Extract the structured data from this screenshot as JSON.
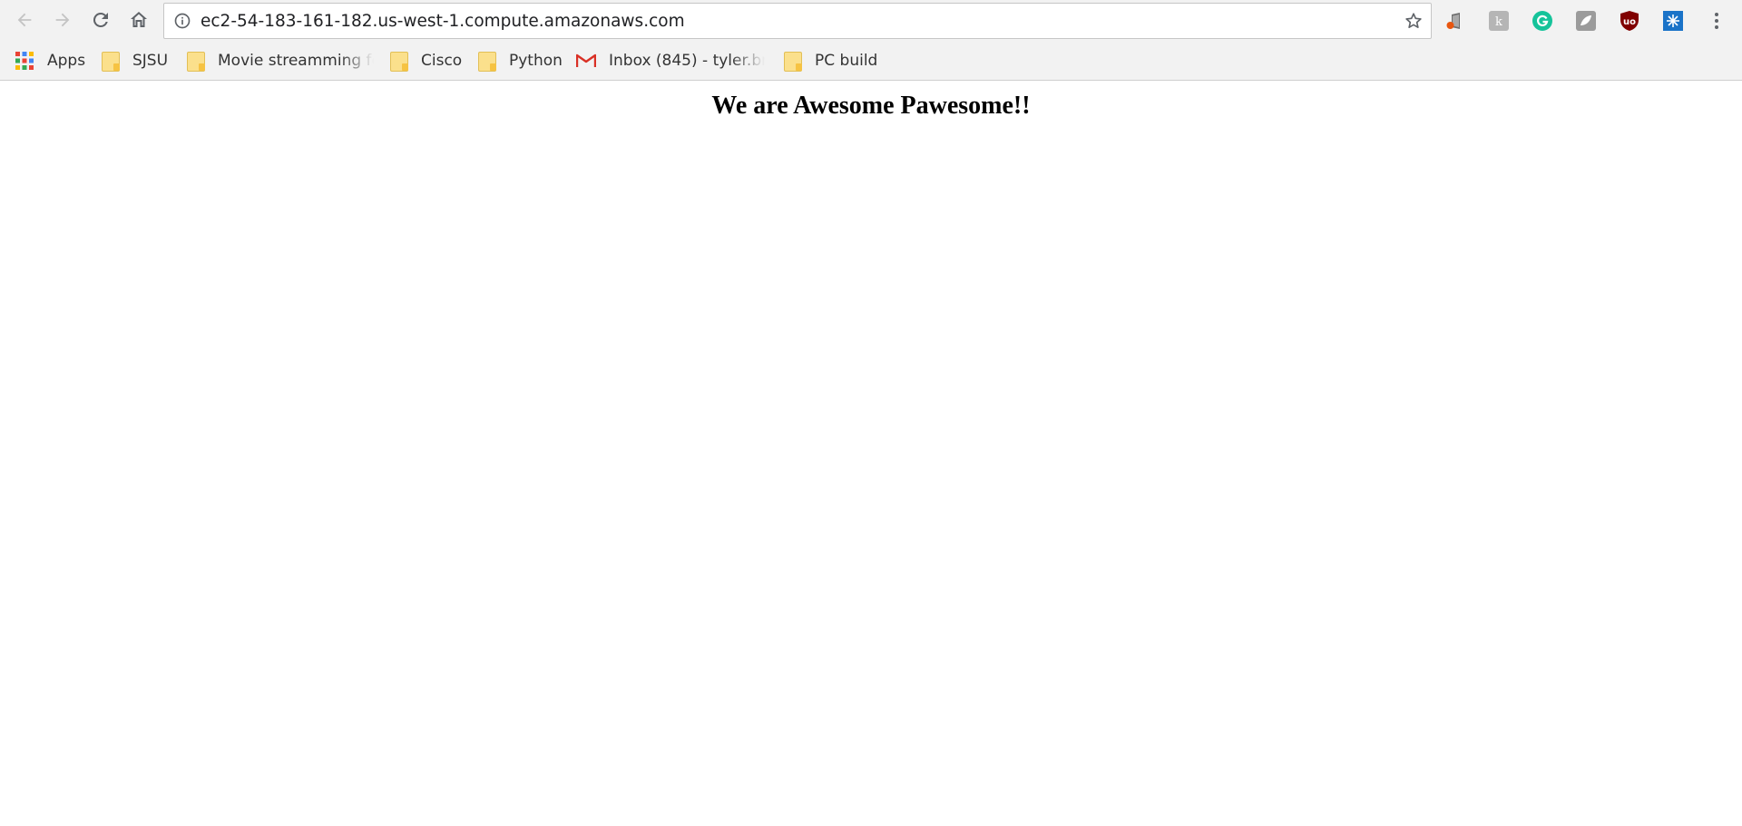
{
  "toolbar": {
    "back_icon": "arrow-left-icon",
    "forward_icon": "arrow-right-icon",
    "reload_icon": "reload-icon",
    "home_icon": "home-icon",
    "url": "ec2-54-183-161-182.us-west-1.compute.amazonaws.com",
    "site_info_icon": "info-icon",
    "bookmark_star_icon": "star-icon",
    "extensions": [
      {
        "name": "office-extension-icon",
        "color": "#e8560f"
      },
      {
        "name": "kami-extension-icon",
        "color": "#b5b5b5"
      },
      {
        "name": "grammarly-extension-icon",
        "color": "#15c39a"
      },
      {
        "name": "gray-extension-icon",
        "color": "#9b9b9b"
      },
      {
        "name": "ublock-extension-icon",
        "color": "#800000"
      },
      {
        "name": "blue-snowflake-extension-icon",
        "color": "#1a73c8"
      }
    ],
    "menu_icon": "more-vert-icon"
  },
  "bookmarks": [
    {
      "label": "Apps",
      "icon": "apps-grid-icon"
    },
    {
      "label": "SJSU",
      "icon": "folder-icon"
    },
    {
      "label": "Movie streamming fo",
      "icon": "folder-icon"
    },
    {
      "label": "Cisco",
      "icon": "folder-icon"
    },
    {
      "label": "Python",
      "icon": "folder-icon"
    },
    {
      "label": "Inbox (845) - tyler.bru",
      "icon": "gmail-icon"
    },
    {
      "label": "PC build",
      "icon": "folder-icon"
    }
  ],
  "page": {
    "heading": "We are Awesome Pawesome!!"
  }
}
